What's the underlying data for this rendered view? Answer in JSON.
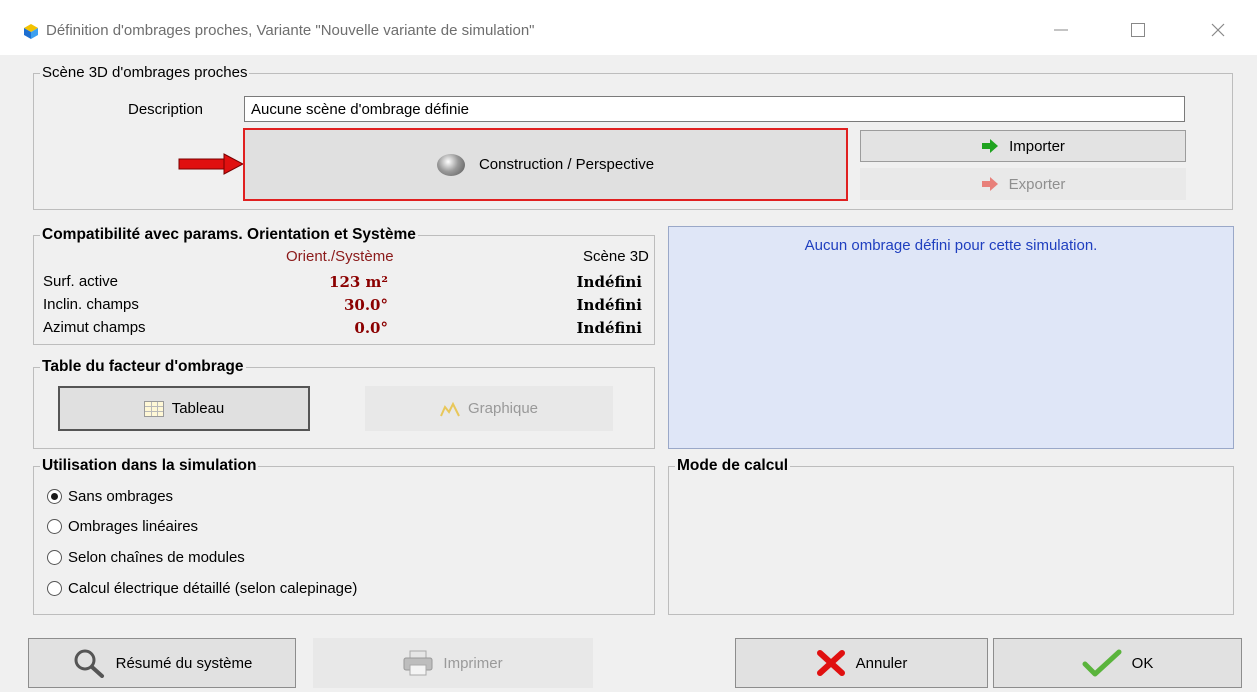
{
  "window": {
    "title": "Définition d'ombrages proches, Variante \"Nouvelle variante de simulation\"",
    "icons": [
      "app-icon",
      "minimize-icon",
      "maximize-icon",
      "close-icon"
    ]
  },
  "scene": {
    "legend": "Scène 3D d'ombrages proches",
    "description_label": "Description",
    "description_value": "Aucune scène d'ombrage définie",
    "construct_label": "Construction / Perspective",
    "import_label": "Importer",
    "export_label": "Exporter"
  },
  "compat": {
    "legend": "Compatibilité avec params. Orientation et Système",
    "header_orient": "Orient./Système",
    "header_scene": "Scène 3D",
    "rows": [
      {
        "label": "Surf. active",
        "value": "123 m²",
        "scene": "Indéfini"
      },
      {
        "label": "Inclin. champs",
        "value": "30.0°",
        "scene": "Indéfini"
      },
      {
        "label": "Azimut champs",
        "value": "0.0°",
        "scene": "Indéfini"
      }
    ]
  },
  "info_panel": {
    "text": "Aucun ombrage défini pour cette simulation."
  },
  "shading_table": {
    "legend": "Table du facteur d'ombrage",
    "tableau_label": "Tableau",
    "graph_label": "Graphique"
  },
  "usage": {
    "legend": "Utilisation dans la simulation",
    "options": [
      {
        "label": "Sans ombrages",
        "checked": true
      },
      {
        "label": "Ombrages linéaires",
        "checked": false
      },
      {
        "label": "Selon chaînes de modules",
        "checked": false
      },
      {
        "label": "Calcul électrique détaillé (selon calepinage)",
        "checked": false
      }
    ]
  },
  "calc_mode": {
    "legend": "Mode de calcul"
  },
  "footer": {
    "summary_label": "Résumé du système",
    "print_label": "Imprimer",
    "cancel_label": "Annuler",
    "ok_label": "OK"
  },
  "colors": {
    "highlight_border": "#e02020",
    "info_bg": "#dfe6f7",
    "info_text": "#1f3fbf",
    "value_red": "#8b0000"
  }
}
